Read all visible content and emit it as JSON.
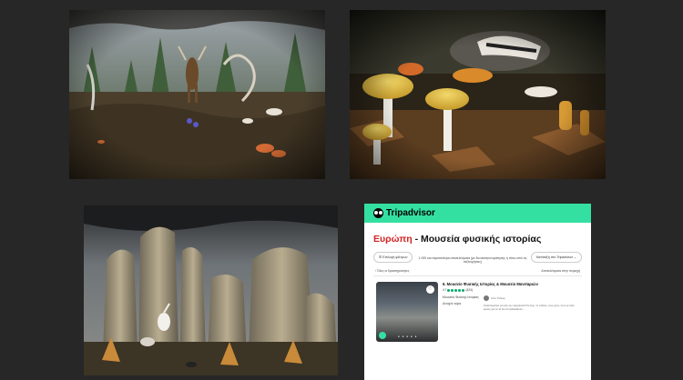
{
  "photos": [
    {
      "subject": "forest-diorama"
    },
    {
      "subject": "mushrooms-badger-diorama"
    },
    {
      "subject": "rock-formations-birds-diorama"
    }
  ],
  "colors": {
    "background": "#272727",
    "tripadvisor_green": "#34e0a1",
    "title_red": "#d32323",
    "rating_green": "#00aa6c"
  },
  "tripadvisor": {
    "brand": "Tripadvisor",
    "title_region": "Ευρώπη",
    "title_rest": " - Μουσεία φυσικής ιστορίας",
    "filter_left": "☰ Επιλογή φίλτρων",
    "filter_right": "Κατάταξη στο Tripadvisor ⌄",
    "info_note": "1.000 και περισσότερα αποτελέσματα (με δυνατότητα κράτησης ή πίσω από τις ταξινομήσεις)",
    "breadcrumb": "‹ Όλες οι δραστηριότητες",
    "results_note": "Αποτελέσματα στην περιοχή",
    "listing_title": "6. Μουσείο Φυσικής Ιστορίας & Μουσείο Μανιταριών",
    "rating_value": "4.7",
    "review_count": "(424)",
    "category": "Μουσεία Φυσικής Ιστορίας",
    "status": "Ανοιχτό τώρα",
    "reviewer": "Από: Στέλιος",
    "review_text": "Καταπληκτικό για όλη την οικογένεια! Ότι ζώο, το σπάνιο, πώς ζουν, πού να πάει κανείς για να τα δει στη Μακεδονία, ..."
  }
}
